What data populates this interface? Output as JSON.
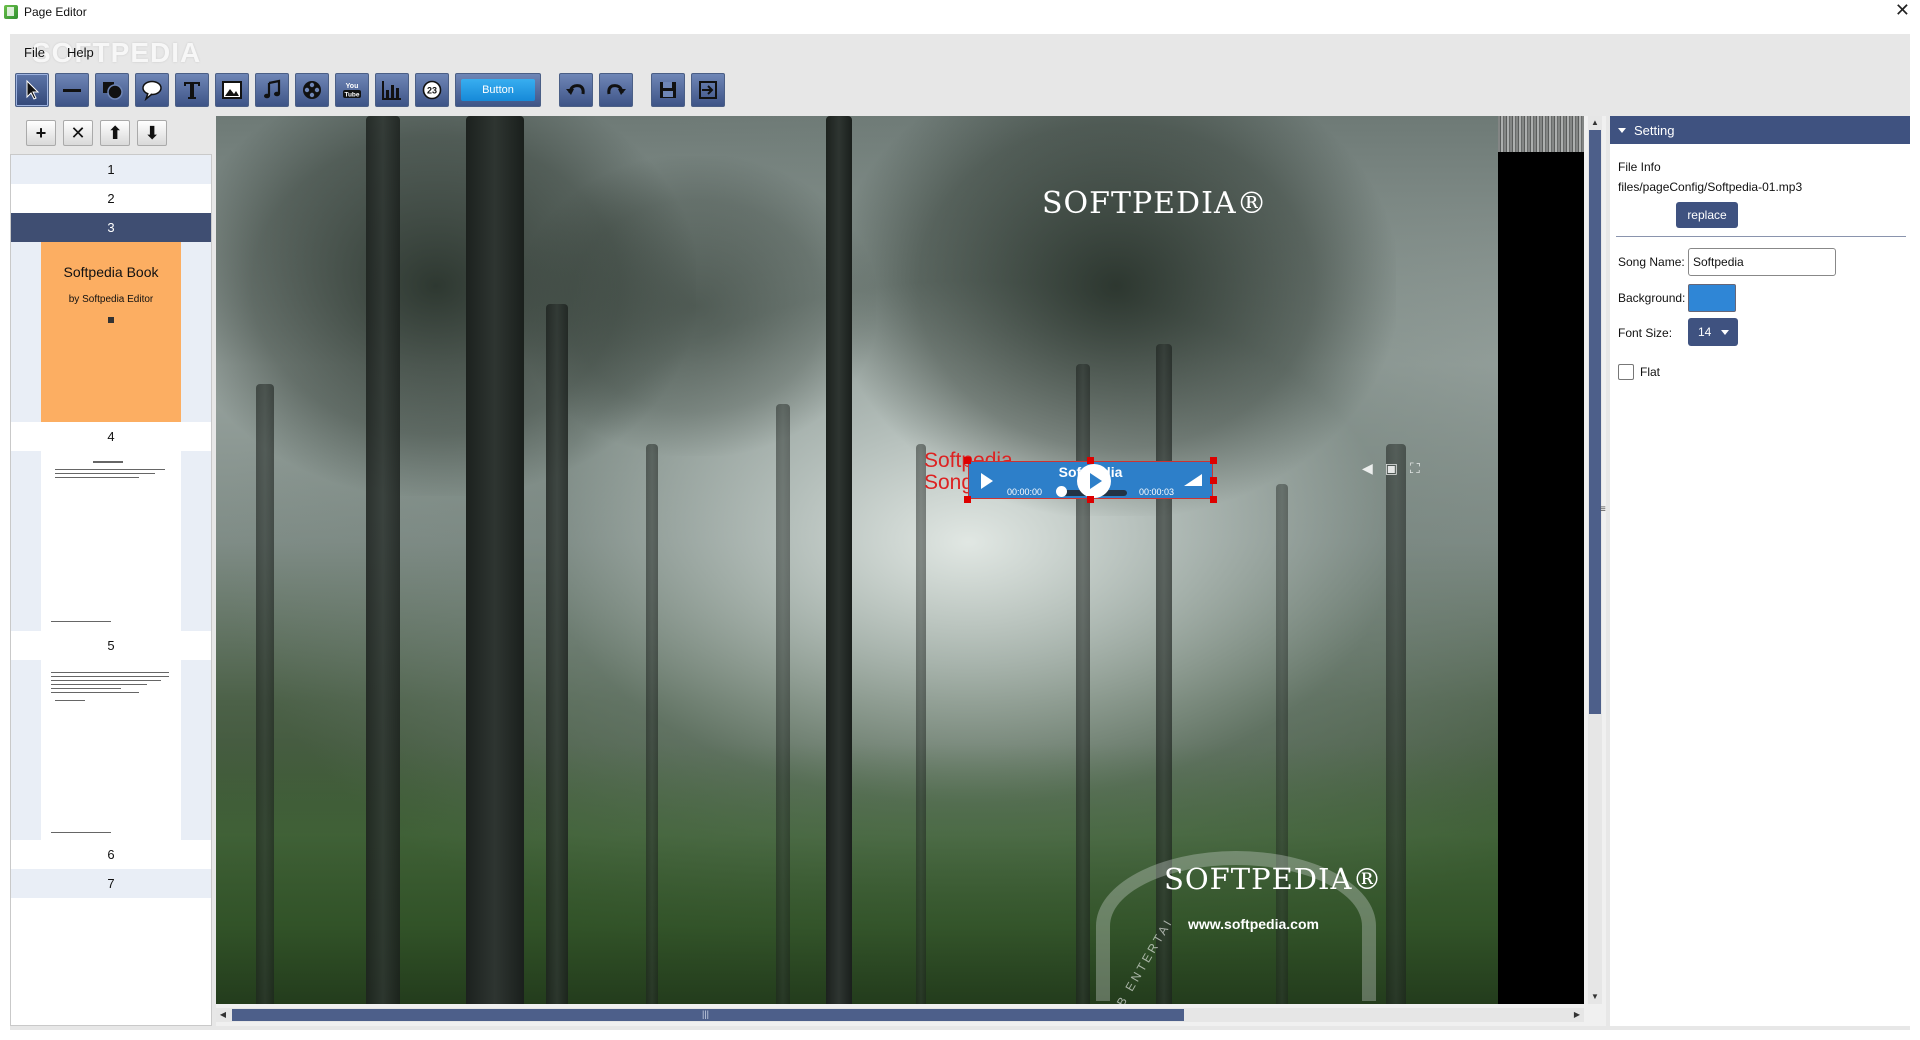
{
  "window": {
    "title": "Page Editor",
    "close": "✕"
  },
  "watermark": "SOFTPEDIA",
  "menu": {
    "file": "File",
    "help": "Help"
  },
  "toolbar": {
    "tools": [
      {
        "name": "select-tool-button",
        "icon": "arrow-cursor-icon",
        "selected": true
      },
      {
        "name": "line-tool-button",
        "icon": "line-icon"
      },
      {
        "name": "shape-tool-button",
        "icon": "shapes-icon"
      },
      {
        "name": "balloon-tool-button",
        "icon": "speech-balloon-icon"
      },
      {
        "name": "text-tool-button",
        "icon": "text-t-icon"
      },
      {
        "name": "image-tool-button",
        "icon": "image-icon"
      },
      {
        "name": "audio-tool-button",
        "icon": "music-note-icon"
      },
      {
        "name": "video-tool-button",
        "icon": "film-reel-icon"
      },
      {
        "name": "youtube-tool-button",
        "icon": "youtube-icon"
      },
      {
        "name": "chart-tool-button",
        "icon": "bar-chart-icon"
      },
      {
        "name": "quiz-tool-button",
        "icon": "quiz-icon"
      }
    ],
    "button_widget_label": "Button",
    "youtube_text": "You Tube"
  },
  "page_tools": {
    "add": "+",
    "delete": "✕",
    "up": "⬆",
    "down": "⬇"
  },
  "pages": {
    "p1": "1",
    "p2": "2",
    "p3": "3",
    "p4": "4",
    "p5": "5",
    "p6": "6",
    "p7": "7",
    "thumb3_title": "Softpedia Book",
    "thumb3_subtitle": "by Softpedia Editor"
  },
  "stage": {
    "logo_top": "SOFTPEDIA®",
    "logo_bottom": "SOFTPEDIA®",
    "url": "www.softpedia.com",
    "web_text": "WEB ENTERTAI",
    "song_label": "Softpedia Song",
    "audio": {
      "name": "Softpedia",
      "time_start": "00:00:00",
      "time_end": "00:00:03"
    }
  },
  "setting": {
    "header": "Setting",
    "file_info_label": "File Info",
    "file_path": "files/pageConfig/Softpedia-01.mp3",
    "replace_label": "replace",
    "song_name_label": "Song Name:",
    "song_name_value": "Softpedia",
    "background_label": "Background:",
    "background_color": "#2f86d6",
    "font_size_label": "Font Size:",
    "font_size_value": "14",
    "flat_label": "Flat",
    "flat_checked": false
  }
}
